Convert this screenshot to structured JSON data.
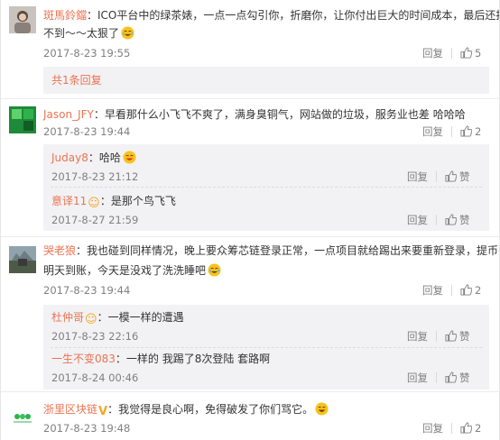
{
  "comments": [
    {
      "user": "斑馬鈴鐺",
      "text1": "：ICO平台中的绿茶婊，一点一点勾引你，折磨你，让你付出巨大的时间成本，最后还抢",
      "text2": "不到～～太狠了",
      "time": "2017-8-23 19:55",
      "reply": "回复",
      "likes": "5",
      "more": "共1条回复"
    },
    {
      "user": "Jason_JFY",
      "text1": "：早看那什么小飞飞不爽了，满身臭铜气，网站做的垃圾，服务业也差 哈哈哈",
      "time": "2017-8-23 19:44",
      "reply": "回复",
      "likes": "2",
      "subs": [
        {
          "user": "Juday8",
          "text": "：哈哈",
          "time": "2017-8-23 21:12",
          "reply": "回复",
          "like": "赞"
        },
        {
          "user": "意译11",
          "text": "：是那个鸟飞飞",
          "time": "2017-8-27 21:59",
          "reply": "回复",
          "like": "赞"
        }
      ]
    },
    {
      "user": "哭老狼",
      "text1": "：我也碰到同样情况，晚上要众筹芯链登录正常，一点项目就给踢出来要重新登录，提币要",
      "text2": "明天到账，今天是没戏了洗洗睡吧",
      "time": "2017-8-23 19:44",
      "reply": "回复",
      "likes": "2",
      "subs": [
        {
          "user": "杜仲哥",
          "text": "：一模一样的遭遇",
          "time": "2017-8-23 22:16",
          "reply": "回复",
          "like": "赞"
        },
        {
          "user": "一生不变083",
          "text": "：一样的  我踢了8次登陆  套路啊",
          "time": "2017-8-24 00:46",
          "reply": "回复",
          "like": "赞"
        }
      ]
    },
    {
      "user": "浙里区块链",
      "text1": "：我觉得是良心啊，免得破发了你们骂它。",
      "time": "2017-8-23 19:48",
      "reply": "回复",
      "likes": "2"
    }
  ],
  "colors": {
    "username": "#eb7350",
    "username_blue": "#507daf",
    "meta": "#808080",
    "subbox": "#f2f2f5"
  },
  "icons": [
    "avatar",
    "crying-laugh-emoji",
    "vip-badge",
    "thumbs-up-icon",
    "grin-emoji"
  ]
}
